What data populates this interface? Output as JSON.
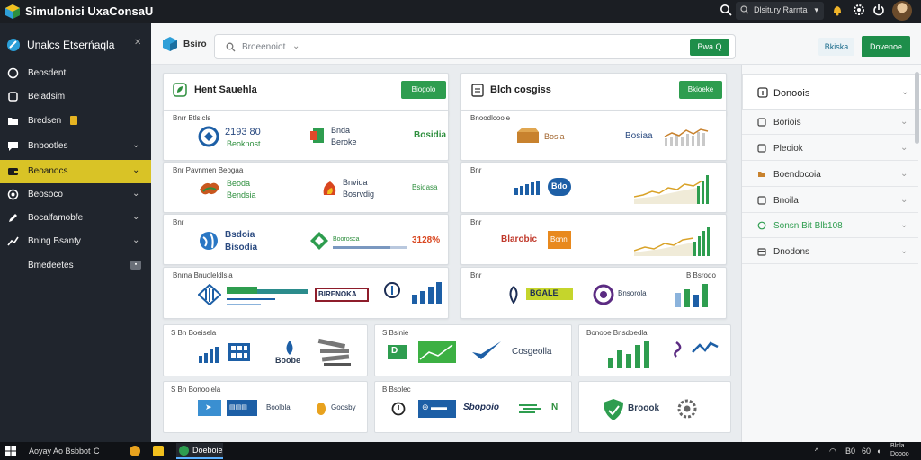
{
  "app": {
    "title": "Simulonici UxaConsaU"
  },
  "topbar": {
    "menu_label": "Dlsitury Rarnta",
    "menu_chevron": "▾"
  },
  "sidebar": {
    "header": "Unalcs Etserńaqla",
    "items": [
      {
        "label": "Beosdent",
        "icon": "circle-icon",
        "chevron": false
      },
      {
        "label": "Beladsim",
        "icon": "square-icon",
        "chevron": false
      },
      {
        "label": "Bredsen",
        "icon": "folder-icon",
        "chevron": false,
        "badge": ""
      },
      {
        "label": "Bnbootles",
        "icon": "chat-icon",
        "chevron": true
      },
      {
        "label": "Beoanocs",
        "icon": "wallet-icon",
        "chevron": true,
        "active": true
      },
      {
        "label": "Beosoco",
        "icon": "target-icon",
        "chevron": true
      },
      {
        "label": "Bocalfamobfe",
        "icon": "pen-icon",
        "chevron": true
      },
      {
        "label": "Bning Bsanty",
        "icon": "chart-icon",
        "chevron": true
      },
      {
        "label": "Bmedeetes",
        "icon": "",
        "chevron": false,
        "badge": "▪"
      }
    ]
  },
  "toolbar": {
    "label": "Bsiro",
    "search_placeholder": "Broeenoiot",
    "search_button": "Bwa Q",
    "btn_secondary": "Bkiska",
    "btn_primary": "Dovenoe"
  },
  "panels": {
    "left": {
      "title": "Hent Sauehla",
      "button": "Biogolo",
      "rows": [
        {
          "label": "Bnrr Btlslcls",
          "texts": [
            "2193 80",
            "Beoknost",
            "Bnda",
            "Beroke",
            "Bosidia"
          ]
        },
        {
          "label": "Bnr Pavnmen Beogaa",
          "texts": [
            "Beoda",
            "Bendsia",
            "Bnvida",
            "Bosrvdig",
            "Bsidasa"
          ]
        },
        {
          "label": "Bnr",
          "texts": [
            "Bsdoia",
            "Bisodia",
            "Boorosca",
            "3128%"
          ]
        }
      ]
    },
    "right": {
      "title": "Blch cosgiss",
      "button": "Bkioeke",
      "rows": [
        {
          "label": "Bnoodlcoole",
          "texts": [
            "Bosia",
            "Bosiaa"
          ]
        },
        {
          "label": "Bnr",
          "texts": [
            "Bdo"
          ]
        },
        {
          "label": "Bnr",
          "texts": [
            "Blarobic",
            "Bonn"
          ]
        }
      ]
    },
    "wide_row": {
      "left_label": "Bnrna Bnuoleldlsia",
      "right_label": "Bnr",
      "right_label_2": "B Bsrodo",
      "texts": [
        "BIRENOKA",
        "BGALE",
        "Bnsorola"
      ]
    },
    "bottom_tiles": [
      {
        "label": "S Bn Boeisela",
        "texts": [
          "Boobe"
        ]
      },
      {
        "label": "S Bsinie",
        "texts": [
          "Cosgeolla"
        ]
      },
      {
        "label": "Bonooe Bnsdoedla",
        "texts": []
      },
      {
        "label": "S Bn Bonoolela",
        "texts": [
          "Boolbla",
          "Goosby"
        ]
      },
      {
        "label": "B Bsolec",
        "texts": [
          "Sbopoio",
          "N"
        ]
      },
      {
        "label": "",
        "texts": [
          "Broook"
        ]
      }
    ]
  },
  "right_panel": {
    "header": "Donoois",
    "items": [
      {
        "label": "Boriois",
        "green": false
      },
      {
        "label": "Pleoiok",
        "green": false
      },
      {
        "label": "Boendocoia",
        "green": false
      },
      {
        "label": "Bnoila",
        "green": false
      },
      {
        "label": "Sonsn Bit Blb108",
        "green": true
      },
      {
        "label": "Dnodons",
        "green": false
      }
    ]
  },
  "taskbar": {
    "search": "Aoyay Ao Bsbbot",
    "c_label": "C",
    "active_app": "Doeboie",
    "tray": [
      "B0",
      "60"
    ],
    "clock_line1": "Blnla",
    "clock_line2": "Doooo"
  },
  "colors": {
    "accent": "#d9c326",
    "primary_green": "#1e8e4a",
    "sidebar": "#20252d",
    "topbar": "#1b1e23"
  }
}
